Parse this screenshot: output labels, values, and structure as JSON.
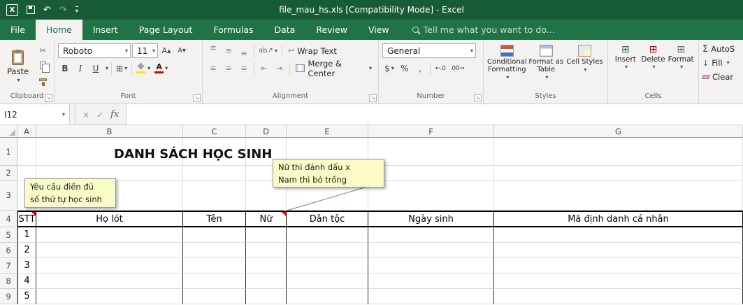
{
  "colors": {
    "titlebar_green": "#185C37",
    "ribbon_green": "#217346",
    "comment_bg": "#FBFBC8",
    "comment_indicator_red": "#FF0000",
    "font_color_swatch": "#E00000",
    "fill_color_swatch": "#FFE600"
  },
  "titlebar": {
    "title": "file_mau_hs.xls  [Compatibility Mode] - Excel"
  },
  "tabs": {
    "file": "File",
    "home": "Home",
    "insert": "Insert",
    "page_layout": "Page Layout",
    "formulas": "Formulas",
    "data": "Data",
    "review": "Review",
    "view": "View",
    "tell_me": "Tell me what you want to do..."
  },
  "ribbon": {
    "clipboard": {
      "label": "Clipboard",
      "paste": "Paste"
    },
    "font": {
      "label": "Font",
      "font_name": "Roboto",
      "font_size": "11",
      "bold": "B",
      "italic": "I",
      "underline": "U",
      "color_letter": "A"
    },
    "alignment": {
      "label": "Alignment",
      "wrap_text": "Wrap Text",
      "merge_center": "Merge & Center"
    },
    "number": {
      "label": "Number",
      "format": "General",
      "dollar": "$",
      "percent": "%",
      "comma": ",",
      "inc_decimal": "←.0",
      "dec_decimal": ".00→"
    },
    "styles": {
      "label": "Styles",
      "conditional": "Conditional Formatting",
      "format_table": "Format as Table",
      "cell_styles": "Cell Styles"
    },
    "cells": {
      "label": "Cells",
      "insert": "Insert",
      "delete": "Delete",
      "format": "Format"
    },
    "editing": {
      "autosum": "AutoS",
      "fill": "Fill",
      "clear": "Clear"
    }
  },
  "formula_bar": {
    "name_box": "I12",
    "cancel": "×",
    "enter": "✓",
    "fx": "fx",
    "formula": ""
  },
  "icons": {
    "dropdown": "▾",
    "undo": "↶",
    "redo": "↷",
    "cut": "✂",
    "borders_grid": "⊞",
    "align_lines": "≡",
    "orientation": "ab↗",
    "outdent": "⇤",
    "indent": "⇥",
    "wrap": "↩",
    "font_bigger": "A▴",
    "font_smaller": "A▾",
    "launcher": "↘",
    "sigma": "Σ",
    "fill_down": "↓",
    "grid": "⊞",
    "excel_logo": "X"
  },
  "sheet": {
    "columns": [
      "A",
      "B",
      "C",
      "D",
      "E",
      "F",
      "G"
    ],
    "rows": [
      "1",
      "2",
      "3",
      "4",
      "5",
      "6",
      "7",
      "8",
      "9"
    ],
    "title": "DANH SÁCH HỌC SINH",
    "comment_stt": {
      "text": "Yêu cầu điền đủ\nsố thứ tự học sinh"
    },
    "comment_nu": {
      "text": "Nữ thì đánh dấu x\nNam thì bỏ trống"
    },
    "table": {
      "headers": [
        "STT",
        "Họ lót",
        "Tên",
        "Nữ",
        "Dân tộc",
        "Ngày sinh",
        "Mã định danh cá nhân"
      ],
      "stt": [
        "1",
        "2",
        "3",
        "4",
        "5"
      ]
    }
  }
}
